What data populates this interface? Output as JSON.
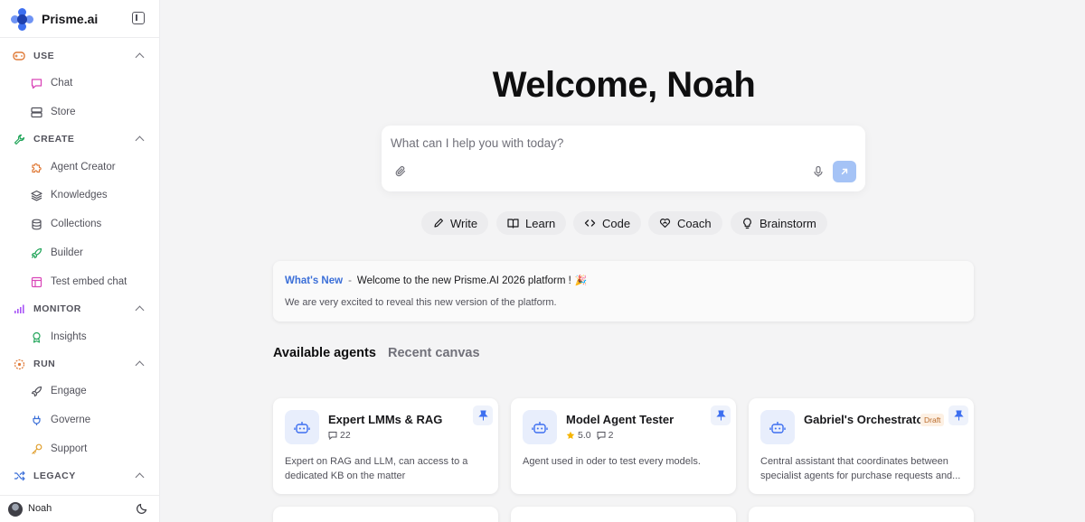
{
  "app": {
    "name": "Prisme.ai"
  },
  "sidebar": {
    "sections": [
      {
        "label": "USE",
        "items": [
          {
            "label": "Chat"
          },
          {
            "label": "Store"
          }
        ]
      },
      {
        "label": "CREATE",
        "items": [
          {
            "label": "Agent Creator"
          },
          {
            "label": "Knowledges"
          },
          {
            "label": "Collections"
          },
          {
            "label": "Builder"
          },
          {
            "label": "Test embed chat"
          }
        ]
      },
      {
        "label": "MONITOR",
        "items": [
          {
            "label": "Insights"
          }
        ]
      },
      {
        "label": "RUN",
        "items": [
          {
            "label": "Engage"
          },
          {
            "label": "Governe"
          },
          {
            "label": "Support"
          }
        ]
      },
      {
        "label": "LEGACY",
        "items": []
      }
    ],
    "user": {
      "name": "Noah"
    }
  },
  "main": {
    "welcome": "Welcome, Noah",
    "prompt": {
      "placeholder": "What can I help you with today?"
    },
    "chips": [
      {
        "label": "Write"
      },
      {
        "label": "Learn"
      },
      {
        "label": "Code"
      },
      {
        "label": "Coach"
      },
      {
        "label": "Brainstorm"
      }
    ],
    "news": {
      "tag": "What's New",
      "separator": "-",
      "title": "Welcome to the new Prisme.AI 2026 platform !",
      "emoji": "🎉",
      "body": "We are very excited to reveal this new version of the platform."
    },
    "tabs": [
      {
        "label": "Available agents"
      },
      {
        "label": "Recent canvas"
      }
    ],
    "agents": [
      {
        "name": "Expert LMMs & RAG",
        "rating": "",
        "comments": "22",
        "draft": "",
        "description": "Expert on RAG and LLM, can access to a dedicated KB on the matter"
      },
      {
        "name": "Model Agent Tester",
        "rating": "5.0",
        "comments": "2",
        "draft": "",
        "description": "Agent used in oder to test every models."
      },
      {
        "name": "Gabriel's Orchestrator",
        "rating": "",
        "comments": "",
        "draft": "Draft",
        "description": "Central assistant that coordinates between specialist agents for purchase requests and..."
      }
    ]
  },
  "colors": {
    "accent": "#3d6ff0",
    "send_button": "#a5c3f6",
    "whats_new": "#3b6fd8",
    "draft_text": "#b96a2a"
  },
  "icons": {
    "sections": [
      "gamepad-icon",
      "wrench-icon",
      "bar-chart-icon",
      "dial-icon",
      "shuffle-icon"
    ],
    "items": [
      "message-square-icon",
      "server-icon",
      "puzzle-icon",
      "layers-icon",
      "database-icon",
      "rocket-icon",
      "layout-icon",
      "award-icon",
      "send-rocket-icon",
      "plug-icon",
      "key-icon"
    ]
  }
}
